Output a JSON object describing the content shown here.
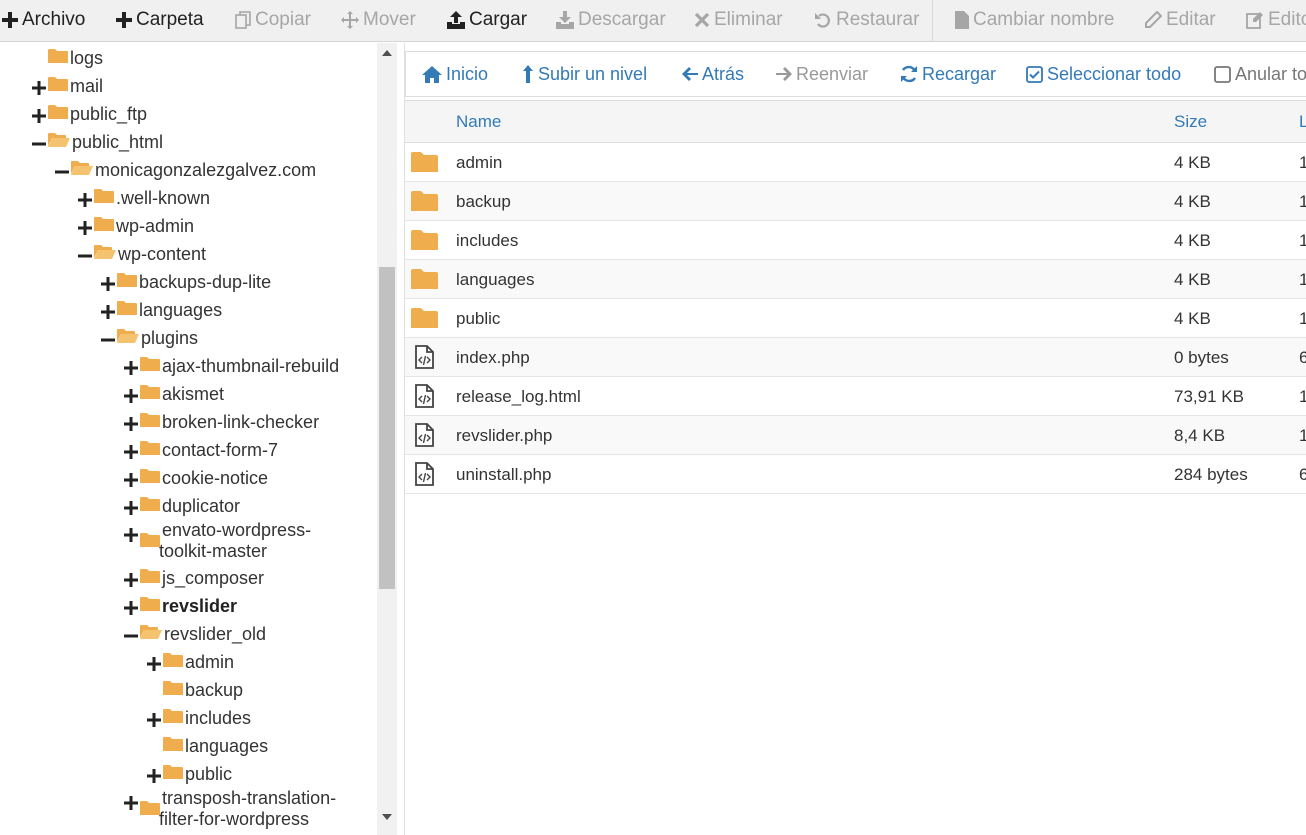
{
  "toolbar": {
    "archivo": "Archivo",
    "carpeta": "Carpeta",
    "copiar": "Copiar",
    "mover": "Mover",
    "cargar": "Cargar",
    "descargar": "Descargar",
    "eliminar": "Eliminar",
    "restaurar": "Restaurar",
    "cambiar_nombre": "Cambiar nombre",
    "editar": "Editar",
    "editar2": "Edito"
  },
  "tree": [
    {
      "label": "logs",
      "toggle": "none"
    },
    {
      "label": "mail",
      "toggle": "plus"
    },
    {
      "label": "public_ftp",
      "toggle": "plus"
    },
    {
      "label": "public_html",
      "toggle": "minus"
    },
    {
      "label": "monicagonzalezgalvez.com",
      "toggle": "minus"
    },
    {
      "label": ".well-known",
      "toggle": "plus"
    },
    {
      "label": "wp-admin",
      "toggle": "plus"
    },
    {
      "label": "wp-content",
      "toggle": "minus"
    },
    {
      "label": "backups-dup-lite",
      "toggle": "plus"
    },
    {
      "label": "languages",
      "toggle": "plus"
    },
    {
      "label": "plugins",
      "toggle": "minus"
    },
    {
      "label": "ajax-thumbnail-rebuild",
      "toggle": "plus"
    },
    {
      "label": "akismet",
      "toggle": "plus"
    },
    {
      "label": "broken-link-checker",
      "toggle": "plus"
    },
    {
      "label": "contact-form-7",
      "toggle": "plus"
    },
    {
      "label": "cookie-notice",
      "toggle": "plus"
    },
    {
      "label": "duplicator",
      "toggle": "plus"
    },
    {
      "label": "envato-wordpress-toolkit-master",
      "line1": "envato-wordpress-",
      "line2": "toolkit-master",
      "toggle": "plus"
    },
    {
      "label": "js_composer",
      "toggle": "plus"
    },
    {
      "label": "revslider",
      "toggle": "plus",
      "bold": true
    },
    {
      "label": "revslider_old",
      "toggle": "minus"
    },
    {
      "label": "admin",
      "toggle": "plus"
    },
    {
      "label": "backup",
      "toggle": "none"
    },
    {
      "label": "includes",
      "toggle": "plus"
    },
    {
      "label": "languages",
      "toggle": "none"
    },
    {
      "label": "public",
      "toggle": "plus"
    },
    {
      "label": "transposh-translation-filter-for-wordpress",
      "line1": "transposh-translation-",
      "line2": "filter-for-wordpress",
      "toggle": "plus"
    }
  ],
  "nav": {
    "inicio": "Inicio",
    "subir": "Subir un nivel",
    "atras": "Atrás",
    "reenviar": "Reenviar",
    "recargar": "Recargar",
    "seleccionar": "Seleccionar todo",
    "anular": "Anular to"
  },
  "columns": {
    "name": "Name",
    "size": "Size",
    "last": "L"
  },
  "files": [
    {
      "name": "admin",
      "size": "4 KB",
      "last": "1",
      "type": "folder"
    },
    {
      "name": "backup",
      "size": "4 KB",
      "last": "1",
      "type": "folder"
    },
    {
      "name": "includes",
      "size": "4 KB",
      "last": "1",
      "type": "folder"
    },
    {
      "name": "languages",
      "size": "4 KB",
      "last": "1",
      "type": "folder"
    },
    {
      "name": "public",
      "size": "4 KB",
      "last": "1",
      "type": "folder"
    },
    {
      "name": "index.php",
      "size": "0 bytes",
      "last": "6",
      "type": "code"
    },
    {
      "name": "release_log.html",
      "size": "73,91 KB",
      "last": "1",
      "type": "code"
    },
    {
      "name": "revslider.php",
      "size": "8,4 KB",
      "last": "1",
      "type": "code"
    },
    {
      "name": "uninstall.php",
      "size": "284 bytes",
      "last": "6",
      "type": "code"
    }
  ],
  "colors": {
    "link": "#337ab7",
    "folder": "#f0ad4e",
    "disabled": "#a6a6a6"
  }
}
